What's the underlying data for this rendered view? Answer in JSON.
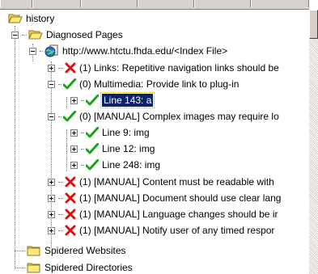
{
  "colors": {
    "selection_bg": "#0a246a",
    "check_green": "#1aa61a",
    "cross_red": "#e01010",
    "folder_yellow": "#f5d94a"
  },
  "tree": {
    "root_label": "history",
    "diagnosed_label": "Diagnosed Pages",
    "url_label": "http://www.htctu.fhda.edu/<Index File>",
    "items": [
      {
        "label": "(1) Links: Repetitive navigation links should be",
        "status": "fail",
        "icon": "red-x-icon"
      },
      {
        "label": "(0) Multimedia: Provide link to plug-in",
        "status": "pass",
        "icon": "green-check-icon"
      },
      {
        "label": "Line 143: a",
        "status": "pass",
        "icon": "green-check-icon",
        "selected": true
      },
      {
        "label": "(0) [MANUAL] Complex images may require lo",
        "status": "pass",
        "icon": "green-check-icon"
      },
      {
        "label": "Line 9: img",
        "status": "pass",
        "icon": "green-check-icon"
      },
      {
        "label": "Line 12: img",
        "status": "pass",
        "icon": "green-check-icon"
      },
      {
        "label": "Line 248: img",
        "status": "pass",
        "icon": "green-check-icon"
      },
      {
        "label": "(1) [MANUAL] Content must be readable with",
        "status": "fail",
        "icon": "red-x-icon"
      },
      {
        "label": "(1) [MANUAL] Document should use clear lang",
        "status": "fail",
        "icon": "red-x-icon"
      },
      {
        "label": "(1) [MANUAL] Language changes should be ir",
        "status": "fail",
        "icon": "red-x-icon"
      },
      {
        "label": "(1) [MANUAL] Notify user of any timed respor",
        "status": "fail",
        "icon": "red-x-icon"
      }
    ],
    "spidered_websites_label": "Spidered Websites",
    "spidered_directories_label": "Spidered Directories"
  }
}
